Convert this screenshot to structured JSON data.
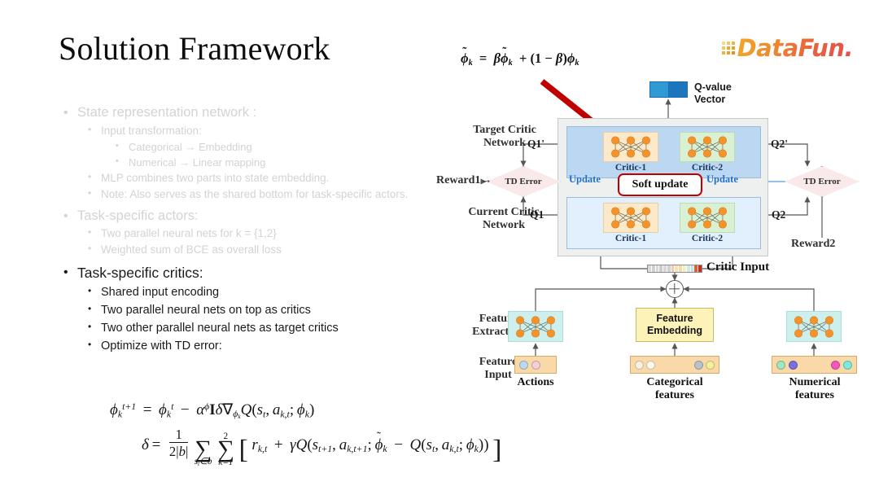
{
  "slide": {
    "title": "Solution Framework"
  },
  "logo": {
    "name": "DataFun.",
    "accent_start": "#f0a828",
    "accent_end": "#e2504a"
  },
  "bullets": [
    {
      "level": 1,
      "text": "State representation network :",
      "state": "faded"
    },
    {
      "level": 2,
      "text": "Input transformation:",
      "state": "faded"
    },
    {
      "level": 3,
      "text": "Categorical → Embedding",
      "state": "faded"
    },
    {
      "level": 3,
      "text": "Numerical → Linear mapping",
      "state": "faded"
    },
    {
      "level": 2,
      "text": "MLP combines two parts into state embedding.",
      "state": "faded"
    },
    {
      "level": 2,
      "text": "Note: Also serves as the shared bottom for task-specific actors.",
      "state": "faded"
    },
    {
      "level": 1,
      "text": "Task-specific actors:",
      "state": "faded"
    },
    {
      "level": 2,
      "text": "Two parallel neural nets for k = {1,2}",
      "state": "faded"
    },
    {
      "level": 2,
      "text": "Weighted sum of BCE as overall loss",
      "state": "faded"
    },
    {
      "level": 1,
      "text": "Task-specific critics:",
      "state": "active"
    },
    {
      "level": 2,
      "text": "Shared input encoding",
      "state": "active"
    },
    {
      "level": 2,
      "text": "Two parallel neural nets on top as critics",
      "state": "active"
    },
    {
      "level": 2,
      "text": "Two other parallel neural nets as target critics",
      "state": "active"
    },
    {
      "level": 2,
      "text": "Optimize with TD error:",
      "state": "active"
    }
  ],
  "equations": {
    "update_rule": "ϕ_k^{t+1} = ϕ_k^t − α^ϕ I δ ∇_{ϕ_k} Q(s_t, a_{k,t}; ϕ_k)",
    "td_error": "δ = 1/(2|b|) Σ_{s_t∈b} Σ_{k=1}^{2} [ r_{k,t} + γ Q(s_{t+1}, a_{k,t+1}; ϕ̃_k − Q(s_t, a_{k,t}; ϕ_k)) ]"
  },
  "diagram": {
    "soft_update_formula": "ϕ̃_k = βϕ̃_k + (1 − β)ϕ_k",
    "qvalue_label_line1": "Q-value",
    "qvalue_label_line2": "Vector",
    "target_network_label_line1": "Target Critic",
    "target_network_label_line2": "Network",
    "current_network_label_line1": "Current Critic",
    "current_network_label_line2": "Network",
    "soft_update_box": "Soft update",
    "td_error_left": "TD Error",
    "td_error_right": "TD Error",
    "reward_left": "Reward1→",
    "reward_right": "Reward2",
    "q_target_1": "Q1'",
    "q_target_2": "Q2'",
    "q_current_1": "Q1",
    "q_current_2": "Q2",
    "update_left": "Update",
    "update_right": "Update",
    "critic_input": "Critic Input",
    "critics": {
      "target_left": "Critic-1",
      "target_right": "Critic-2",
      "current_left": "Critic-1",
      "current_right": "Critic-2"
    },
    "feature_extraction_label_line1": "Feature",
    "feature_extraction_label_line2": "Extraction",
    "feature_input_label_line1": "Feature",
    "feature_input_label_line2": "Input",
    "feature_embedding_line1": "Feature",
    "feature_embedding_line2": "Embedding",
    "actions_label": "Actions",
    "categorical_label_line1": "Categorical",
    "categorical_label_line2": "features",
    "numerical_label_line1": "Numerical",
    "numerical_label_line2": "features",
    "colors": {
      "target_row": "#bcd7f2",
      "current_row": "#e2effc",
      "critic1_net": "#fce9c9",
      "critic2_net": "#d9f0d3",
      "feature_net": "#cdf0ec",
      "embedding_box": "#fdf2b8",
      "input_box": "#fad9a8",
      "td_diamond": "#fae9e9",
      "soft_update_border": "#c00000",
      "arrow_red": "#c00000",
      "update_text": "#1f6fd0",
      "qvalue_cell1": "#2f9ad4",
      "qvalue_cell2": "#1b76bd"
    }
  }
}
